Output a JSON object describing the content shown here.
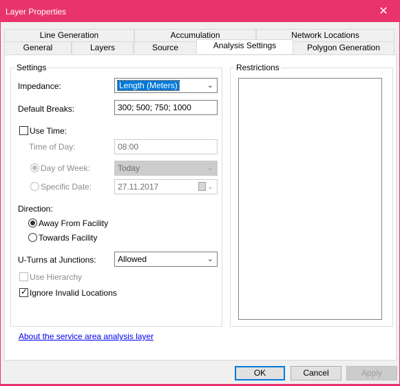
{
  "window": {
    "title": "Layer Properties",
    "close_glyph": "✕"
  },
  "tabs": {
    "row_top": [
      "Line Generation",
      "Accumulation",
      "Network Locations"
    ],
    "row_bottom": [
      "General",
      "Layers",
      "Source",
      "Analysis Settings",
      "Polygon Generation"
    ],
    "active": "Analysis Settings"
  },
  "settings": {
    "group_title": "Settings",
    "impedance_label": "Impedance:",
    "impedance_value": "Length (Meters)",
    "default_breaks_label": "Default Breaks:",
    "default_breaks_value": "300; 500; 750; 1000",
    "use_time_label": "Use Time:",
    "use_time_checked": false,
    "time_of_day_label": "Time of Day:",
    "time_of_day_value": "08:00",
    "day_of_week_label": "Day of Week:",
    "day_of_week_value": "Today",
    "specific_date_label": "Specific Date:",
    "specific_date_value": "27.11.2017",
    "direction_label": "Direction:",
    "away_label": "Away From Facility",
    "towards_label": "Towards Facility",
    "direction_selected": "Away From Facility",
    "uturns_label": "U-Turns at Junctions:",
    "uturns_value": "Allowed",
    "use_hierarchy_label": "Use Hierarchy",
    "ignore_invalid_label": "Ignore Invalid Locations",
    "ignore_invalid_checked": true
  },
  "restrictions": {
    "group_title": "Restrictions"
  },
  "link_text": "About the service area analysis layer",
  "buttons": {
    "ok": "OK",
    "cancel": "Cancel",
    "apply": "Apply"
  },
  "icons": {
    "dropdown": "chevron-down-icon",
    "checkmark": "check-icon",
    "calendar": "calendar-icon",
    "close": "close-icon"
  },
  "colors": {
    "titlebar": "#e8336d",
    "selection": "#0078d7",
    "link": "#0000ee"
  }
}
